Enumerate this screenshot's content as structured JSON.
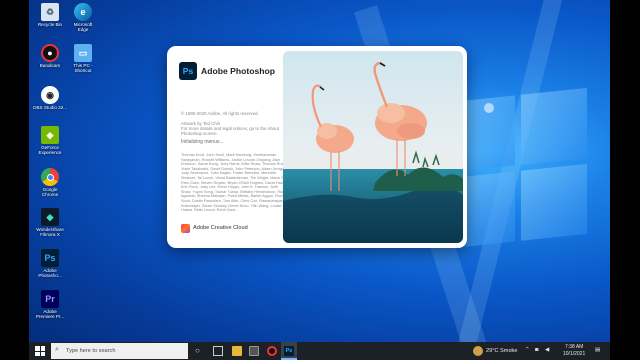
{
  "desktop": {
    "icons": [
      {
        "name": "recycle-bin-icon",
        "label": "Recycle Bin"
      },
      {
        "name": "microsoft-edge-icon",
        "label": "Microsoft\nEdge"
      },
      {
        "name": "bandicam-icon",
        "label": "Bandicam"
      },
      {
        "name": "this-pc-icon",
        "label": "This PC -\nShortcut"
      },
      {
        "name": "obs-icon",
        "label": "OBS Studio 32..."
      },
      {
        "name": "geforce-experience-icon",
        "label": "GeForce\nExperience"
      },
      {
        "name": "google-chrome-icon",
        "label": "Google\nChrome"
      },
      {
        "name": "wondershare-filmora-icon",
        "label": "Wondershare\nFilmora X"
      },
      {
        "name": "photoshop-shortcut-icon",
        "label": "Adobe\nPhotosho..."
      },
      {
        "name": "premiere-shortcut-icon",
        "label": "Adobe\nPremiere Pr..."
      }
    ]
  },
  "splash": {
    "logo_text": "Ps",
    "title": "Adobe Photoshop",
    "copyright": "© 1990-2020 Adobe. All rights reserved.",
    "artwork_credit": "Artwork by Ted Chin\nFor more details and legal notices, go to the About Photoshop screen.",
    "status": "Initializing menus...",
    "credits": "Thomas Knoll, John Knoll, Mark Hamburg, Seetharaman Narayanan, Russell Williams, Jackie Lincoln-Owyang, Alan Erickson, Sarah Kong, Jerry Harris, Mike Shaw, Thomas Ruark, Yukie Takahashi, David Dobish, John Peterson, Adam Jerugim, Judy Severance, Yuko Kagita, Foster Brereton, Meredith Stotzner, Tai Luxon, Vinod Balakrishnan, Tim Wright, Maria Yap, Pam Clark, Steven Snyder, Bryan O'Neil Hughes, David Hackel, Eric Floch, Judy Lee, Kevin Hopps, John E. Hanson, Seth Shaw, Yuyan Song, Tushar Turkar, Brittany Hendrickson, Ruby Agarwal, Sheena Mahajan, Pulkit Mehta, Barkin Aygun, Ruchi Sood, Dustin Passofaro, Tom Attix, Chris Cox, Ramanarayanan Krishnaiyer, Sarah Stuckey, Derek Novo, Yilin Wang, Louise Huang, Betty Leong, Rohit Garg...",
    "footer_label": "Adobe Creative Cloud"
  },
  "taskbar": {
    "search_placeholder": "Type here to search",
    "weather": "29°C  Smoke",
    "time": "7:38 AM",
    "date": "10/1/2021"
  },
  "colors": {
    "photoshop_blue": "#31a8ff",
    "photoshop_bg": "#001e36",
    "premiere_purple": "#9999ff",
    "premiere_bg": "#00005b",
    "taskbar_bg": "#1c2127"
  }
}
